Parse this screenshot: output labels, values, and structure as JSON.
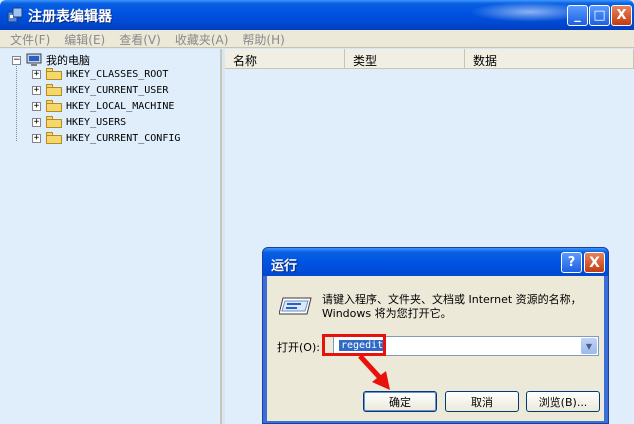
{
  "window": {
    "title": "注册表编辑器",
    "minimize_label": "_",
    "maximize_label": "□",
    "close_label": "X"
  },
  "menu": {
    "items": [
      "文件(F)",
      "编辑(E)",
      "查看(V)",
      "收藏夹(A)",
      "帮助(H)"
    ]
  },
  "tree": {
    "root_label": "我的电脑",
    "root_expander": "−",
    "children": [
      {
        "label": "HKEY_CLASSES_ROOT",
        "expander": "+"
      },
      {
        "label": "HKEY_CURRENT_USER",
        "expander": "+"
      },
      {
        "label": "HKEY_LOCAL_MACHINE",
        "expander": "+"
      },
      {
        "label": "HKEY_USERS",
        "expander": "+"
      },
      {
        "label": "HKEY_CURRENT_CONFIG",
        "expander": "+"
      }
    ]
  },
  "list": {
    "columns": [
      "名称",
      "类型",
      "数据"
    ]
  },
  "run_dialog": {
    "title": "运行",
    "help_label": "?",
    "close_label": "X",
    "description": "请键入程序、文件夹、文档或 Internet 资源的名称，Windows 将为您打开它。",
    "open_label": "打开(O):",
    "input_value": "regedit",
    "ok_label": "确定",
    "cancel_label": "取消",
    "browse_label": "浏览(B)..."
  },
  "colors": {
    "annotation_red": "#e8120c",
    "titlebar_blue": "#0054e3",
    "pane_background": "#dfeefa"
  }
}
